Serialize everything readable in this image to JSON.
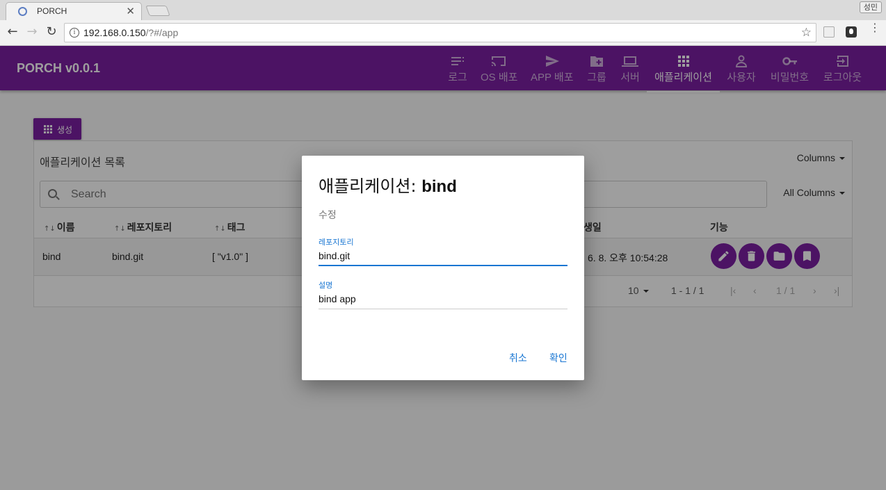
{
  "browser": {
    "tab_title": "PORCH",
    "tab_close": "✕",
    "profile": "성민",
    "url_host": "192.168.0.150",
    "url_path": "/?#/app",
    "back": "←",
    "forward": "→",
    "reload": "↻",
    "star": "☆",
    "info": "i",
    "kebab": "⋮"
  },
  "app": {
    "brand": "PORCH v0.0.1",
    "nav": [
      {
        "label": "로그",
        "icon": "list-icon"
      },
      {
        "label": "OS 배포",
        "icon": "cast-icon"
      },
      {
        "label": "APP 배포",
        "icon": "send-icon"
      },
      {
        "label": "그룹",
        "icon": "folder-plus-icon"
      },
      {
        "label": "서버",
        "icon": "laptop-icon"
      },
      {
        "label": "애플리케이션",
        "icon": "apps-icon",
        "active": true
      },
      {
        "label": "사용자",
        "icon": "person-icon"
      },
      {
        "label": "비밀번호",
        "icon": "key-icon"
      },
      {
        "label": "로그아웃",
        "icon": "logout-icon"
      }
    ],
    "accent": "#7b1fa2"
  },
  "main": {
    "create_label": "생성",
    "list_title": "애플리케이션 목록",
    "columns_label": "Columns",
    "all_columns_label": "All Columns",
    "search_placeholder": "Search",
    "headers": {
      "name": "이름",
      "repo": "레포지토리",
      "tag": "태그",
      "created": "생일",
      "actions": "기능"
    },
    "sort_glyph": "↑↓",
    "rows": [
      {
        "name": "bind",
        "repo": "bind.git",
        "tag": "[ \"v1.0\" ]",
        "created": "6. 8. 오후 10:54:28"
      }
    ],
    "pager": {
      "page_size": "10",
      "range": "1 - 1 / 1",
      "pages": "1 / 1",
      "first": "|‹",
      "prev": "‹",
      "next": "›",
      "last": "›|"
    }
  },
  "dialog": {
    "title_prefix": "애플리케이션: ",
    "title_name": "bind",
    "subtitle": "수정",
    "repo_label": "레포지토리",
    "repo_value": "bind.git",
    "desc_label": "설명",
    "desc_value": "bind app",
    "cancel": "취소",
    "confirm": "확인"
  }
}
